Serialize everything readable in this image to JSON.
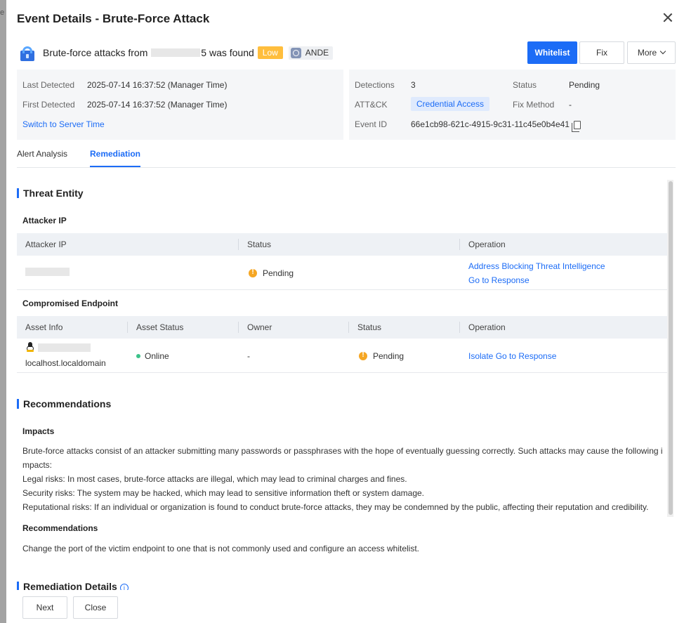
{
  "backdrop": {
    "fragment": "e"
  },
  "header": {
    "title": "Event Details - Brute-Force Attack",
    "close_label": "×"
  },
  "event": {
    "title_prefix": "Brute-force attacks from",
    "title_mid": "",
    "title_suffix": "5 was found",
    "level": "Low",
    "source": "ANDE"
  },
  "actions": {
    "whitelist": "Whitelist",
    "fix": "Fix",
    "more": "More"
  },
  "info_left": {
    "last_detected_label": "Last Detected",
    "last_detected_value": "2025-07-14 16:37:52 (Manager Time)",
    "first_detected_label": "First Detected",
    "first_detected_value": "2025-07-14 16:37:52 (Manager Time)",
    "switch_link": "Switch to Server Time"
  },
  "info_right": {
    "detections_label": "Detections",
    "detections_value": "3",
    "status_label": "Status",
    "status_value": "Pending",
    "attck_label": "ATT&CK",
    "attck_value": "Credential Access",
    "fix_method_label": "Fix Method",
    "fix_method_value": "-",
    "event_id_label": "Event ID",
    "event_id_value": "66e1cb98-621c-4915-9c31-11c45e0b4e41"
  },
  "tabs": [
    "Alert Analysis",
    "Remediation"
  ],
  "threat_entity": {
    "title": "Threat Entity",
    "attacker_ip_subtitle": "Attacker IP",
    "attacker_table": {
      "headers": [
        "Attacker IP",
        "Status",
        "Operation"
      ],
      "row": {
        "ip": "",
        "status": "Pending",
        "op1": "Address Blocking Threat Intelligence",
        "op2": "Go to Response"
      }
    },
    "endpoint_subtitle": "Compromised Endpoint",
    "endpoint_table": {
      "headers": [
        "Asset Info",
        "Asset Status",
        "Owner",
        "Status",
        "Operation"
      ],
      "row": {
        "hostname": "localhost.localdomain",
        "asset_status": "Online",
        "owner": "-",
        "status": "Pending",
        "operation": "Isolate Go to Response"
      }
    }
  },
  "recommendations": {
    "title": "Recommendations",
    "impacts_title": "Impacts",
    "impacts_line1": "Brute-force attacks consist of an attacker submitting many passwords or passphrases with the hope of eventually guessing correctly. Such attacks may cause the following i",
    "impacts_line2": "mpacts:",
    "legal": "Legal risks: In most cases, brute-force attacks are illegal, which may lead to criminal charges and fines.",
    "security": "Security risks: The system may be hacked, which may lead to sensitive information theft or system damage.",
    "reputational": "Reputational risks: If an individual or organization is found to conduct brute-force attacks, they may be condemned by the public, affecting their reputation and credibility.",
    "rec_title": "Recommendations",
    "rec_text": "Change the port of the victim endpoint to one that is not commonly used and configure an access whitelist."
  },
  "remediation_details": {
    "title": "Remediation Details"
  },
  "footer": {
    "next": "Next",
    "close": "Close"
  }
}
